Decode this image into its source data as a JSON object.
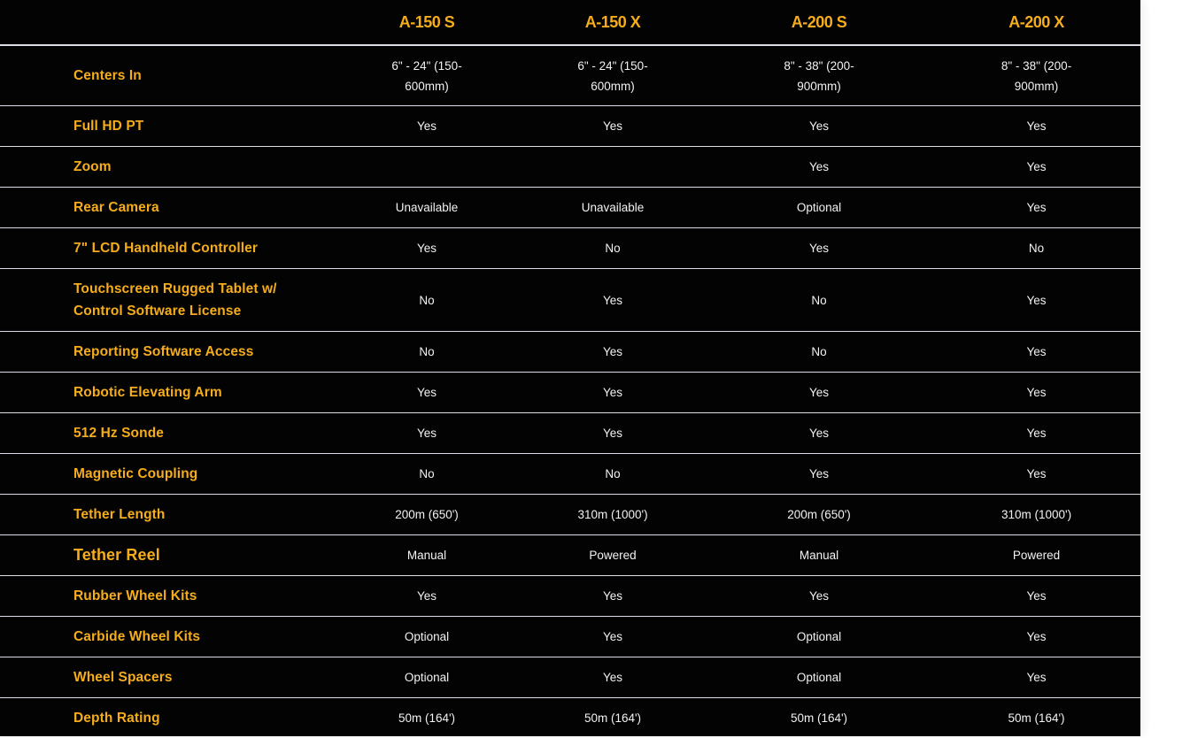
{
  "models": [
    "A-150 S",
    "A-150 X",
    "A-200 S",
    "A-200 X"
  ],
  "rows": [
    {
      "feature": "Centers In",
      "values": [
        "6\" - 24\" (150-600mm)",
        "6\" - 24\" (150-600mm)",
        "8\" - 38\" (200-900mm)",
        "8\" - 38\" (200-900mm)"
      ]
    },
    {
      "feature": "Full HD PT",
      "values": [
        "Yes",
        "Yes",
        "Yes",
        "Yes"
      ]
    },
    {
      "feature": "Zoom",
      "values": [
        "",
        "",
        "Yes",
        "Yes"
      ]
    },
    {
      "feature": "Rear Camera",
      "values": [
        "Unavailable",
        "Unavailable",
        "Optional",
        "Yes"
      ]
    },
    {
      "feature": "7\" LCD Handheld Controller",
      "values": [
        "Yes",
        "No",
        "Yes",
        "No"
      ]
    },
    {
      "feature": "Touchscreen Rugged Tablet w/ Control Software License",
      "values": [
        "No",
        "Yes",
        "No",
        "Yes"
      ]
    },
    {
      "feature": "Reporting Software Access",
      "values": [
        "No",
        "Yes",
        "No",
        "Yes"
      ]
    },
    {
      "feature": "Robotic Elevating Arm",
      "values": [
        "Yes",
        "Yes",
        "Yes",
        "Yes"
      ]
    },
    {
      "feature": "512 Hz Sonde",
      "values": [
        "Yes",
        "Yes",
        "Yes",
        "Yes"
      ]
    },
    {
      "feature": "Magnetic Coupling",
      "values": [
        "No",
        "No",
        "Yes",
        "Yes"
      ]
    },
    {
      "feature": "Tether Length",
      "values": [
        "200m (650')",
        "310m (1000')",
        "200m (650')",
        "310m (1000')"
      ]
    },
    {
      "feature": "Tether Reel",
      "values": [
        "Manual",
        "Powered",
        "Manual",
        "Powered"
      ]
    },
    {
      "feature": "Rubber Wheel Kits",
      "values": [
        "Yes",
        "Yes",
        "Yes",
        "Yes"
      ]
    },
    {
      "feature": "Carbide Wheel Kits",
      "values": [
        "Optional",
        "Yes",
        "Optional",
        "Yes"
      ]
    },
    {
      "feature": "Wheel Spacers",
      "values": [
        "Optional",
        "Yes",
        "Optional",
        "Yes"
      ]
    },
    {
      "feature": "Depth Rating",
      "values": [
        "50m (164')",
        "50m (164')",
        "50m (164')",
        "50m (164')"
      ]
    }
  ],
  "colors": {
    "accent": "#f6ad1b",
    "background": "#030303",
    "text": "#f2f2f2",
    "divider": "#dbe0e8"
  }
}
